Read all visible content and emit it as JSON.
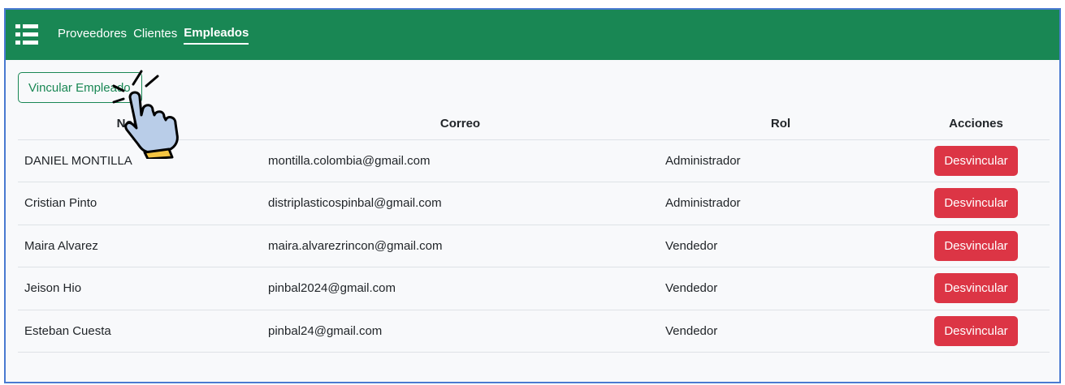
{
  "nav": {
    "menu_icon": "list-icon",
    "links": [
      "Proveedores",
      "Clientes",
      "Empleados"
    ],
    "active": "Empleados"
  },
  "actions": {
    "link_employee_label": "Vincular Empleado"
  },
  "table": {
    "headers": [
      "Nombre",
      "Correo",
      "Rol",
      "Acciones"
    ],
    "rows": [
      {
        "name": "DANIEL MONTILLA",
        "email": "montilla.colombia@gmail.com",
        "role": "Administrador",
        "action": "Desvincular"
      },
      {
        "name": "Cristian Pinto",
        "email": "distriplasticospinbal@gmail.com",
        "role": "Administrador",
        "action": "Desvincular"
      },
      {
        "name": "Maira Alvarez",
        "email": "maira.alvarezrincon@gmail.com",
        "role": "Vendedor",
        "action": "Desvincular"
      },
      {
        "name": "Jeison Hio",
        "email": "pinbal2024@gmail.com",
        "role": "Vendedor",
        "action": "Desvincular"
      },
      {
        "name": "Esteban Cuesta",
        "email": "pinbal24@gmail.com",
        "role": "Vendedor",
        "action": "Desvincular"
      }
    ]
  },
  "overlay": {
    "icon": "pointing-hand-click-icon"
  },
  "colors": {
    "navbar": "#198754",
    "danger": "#dc3545",
    "frame_border": "#4a7ad1"
  }
}
